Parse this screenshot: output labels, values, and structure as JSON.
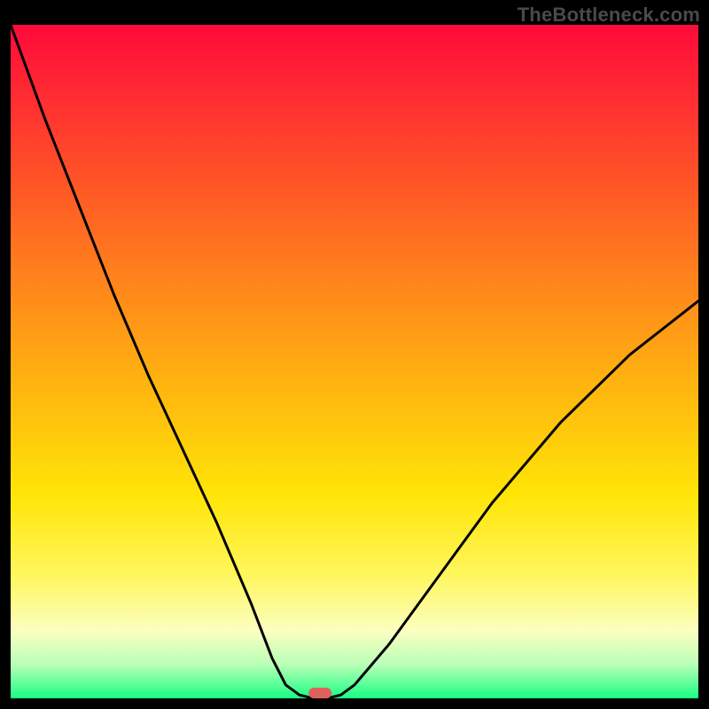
{
  "watermark": "TheBottleneck.com",
  "chart_data": {
    "type": "line",
    "title": "",
    "xlabel": "",
    "ylabel": "",
    "x": [
      0.0,
      0.05,
      0.1,
      0.15,
      0.2,
      0.25,
      0.3,
      0.35,
      0.38,
      0.4,
      0.42,
      0.44,
      0.46,
      0.48,
      0.5,
      0.55,
      0.6,
      0.65,
      0.7,
      0.75,
      0.8,
      0.85,
      0.9,
      0.95,
      1.0
    ],
    "values": [
      1.0,
      0.86,
      0.73,
      0.6,
      0.48,
      0.37,
      0.26,
      0.14,
      0.06,
      0.02,
      0.005,
      0.0,
      0.0,
      0.005,
      0.02,
      0.08,
      0.15,
      0.22,
      0.29,
      0.35,
      0.41,
      0.46,
      0.51,
      0.55,
      0.59
    ],
    "xlim": [
      0,
      1
    ],
    "ylim": [
      0,
      1
    ],
    "bottleneck_x": 0.45,
    "gradient_stops": [
      {
        "offset": 0.0,
        "color": "#ff0a3a"
      },
      {
        "offset": 0.1,
        "color": "#ff2a33"
      },
      {
        "offset": 0.25,
        "color": "#ff5a25"
      },
      {
        "offset": 0.4,
        "color": "#ff8a1a"
      },
      {
        "offset": 0.55,
        "color": "#ffb90f"
      },
      {
        "offset": 0.7,
        "color": "#ffe507"
      },
      {
        "offset": 0.82,
        "color": "#fff760"
      },
      {
        "offset": 0.9,
        "color": "#fbffc0"
      },
      {
        "offset": 0.95,
        "color": "#b9ffb7"
      },
      {
        "offset": 1.0,
        "color": "#18ff84"
      }
    ],
    "marker_color": "#e06060"
  }
}
